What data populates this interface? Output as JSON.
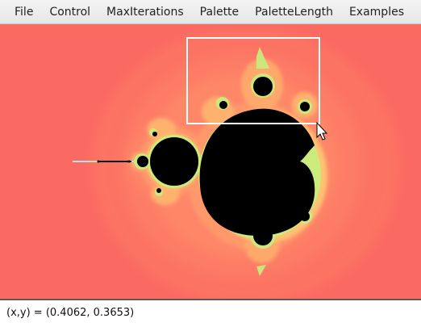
{
  "menu": {
    "items": [
      {
        "label": "File"
      },
      {
        "label": "Control"
      },
      {
        "label": "MaxIterations"
      },
      {
        "label": "Palette"
      },
      {
        "label": "PaletteLength"
      },
      {
        "label": "Examples"
      }
    ]
  },
  "viewer": {
    "set_color": "#000000",
    "background_color": "#fb6a62",
    "halo_colors": [
      "#fd7b64",
      "#fe8f68",
      "#ffa76c",
      "#ffd277",
      "#c9f07e"
    ]
  },
  "status": {
    "coords_text": "(x,y) = (0.4062, 0.3653)"
  }
}
